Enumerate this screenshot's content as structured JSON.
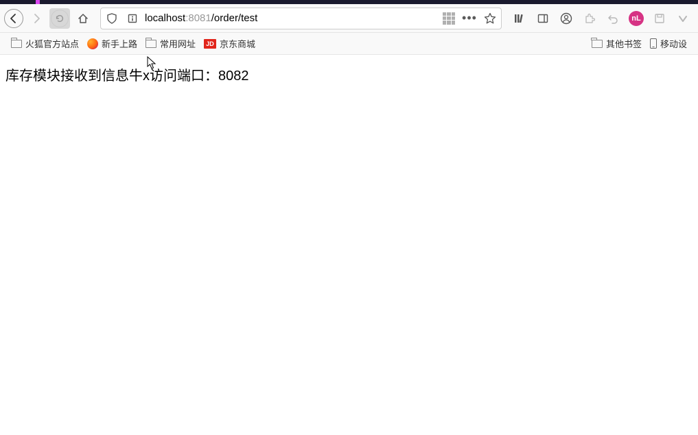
{
  "url": {
    "host": "localhost",
    "port": ":8081",
    "path": "/order/test"
  },
  "bookmarks": {
    "left": [
      {
        "label": "火狐官方站点",
        "icon": "folder"
      },
      {
        "label": "新手上路",
        "icon": "firefox"
      },
      {
        "label": "常用网址",
        "icon": "folder"
      },
      {
        "label": "京东商城",
        "icon": "jd"
      }
    ],
    "right": [
      {
        "label": "其他书签",
        "icon": "folder"
      },
      {
        "label": "移动设",
        "icon": "phone"
      }
    ]
  },
  "page": {
    "body_text": "库存模块接收到信息牛x访问端口：8082"
  },
  "toolbar_ext": {
    "nl_label": "nL"
  }
}
